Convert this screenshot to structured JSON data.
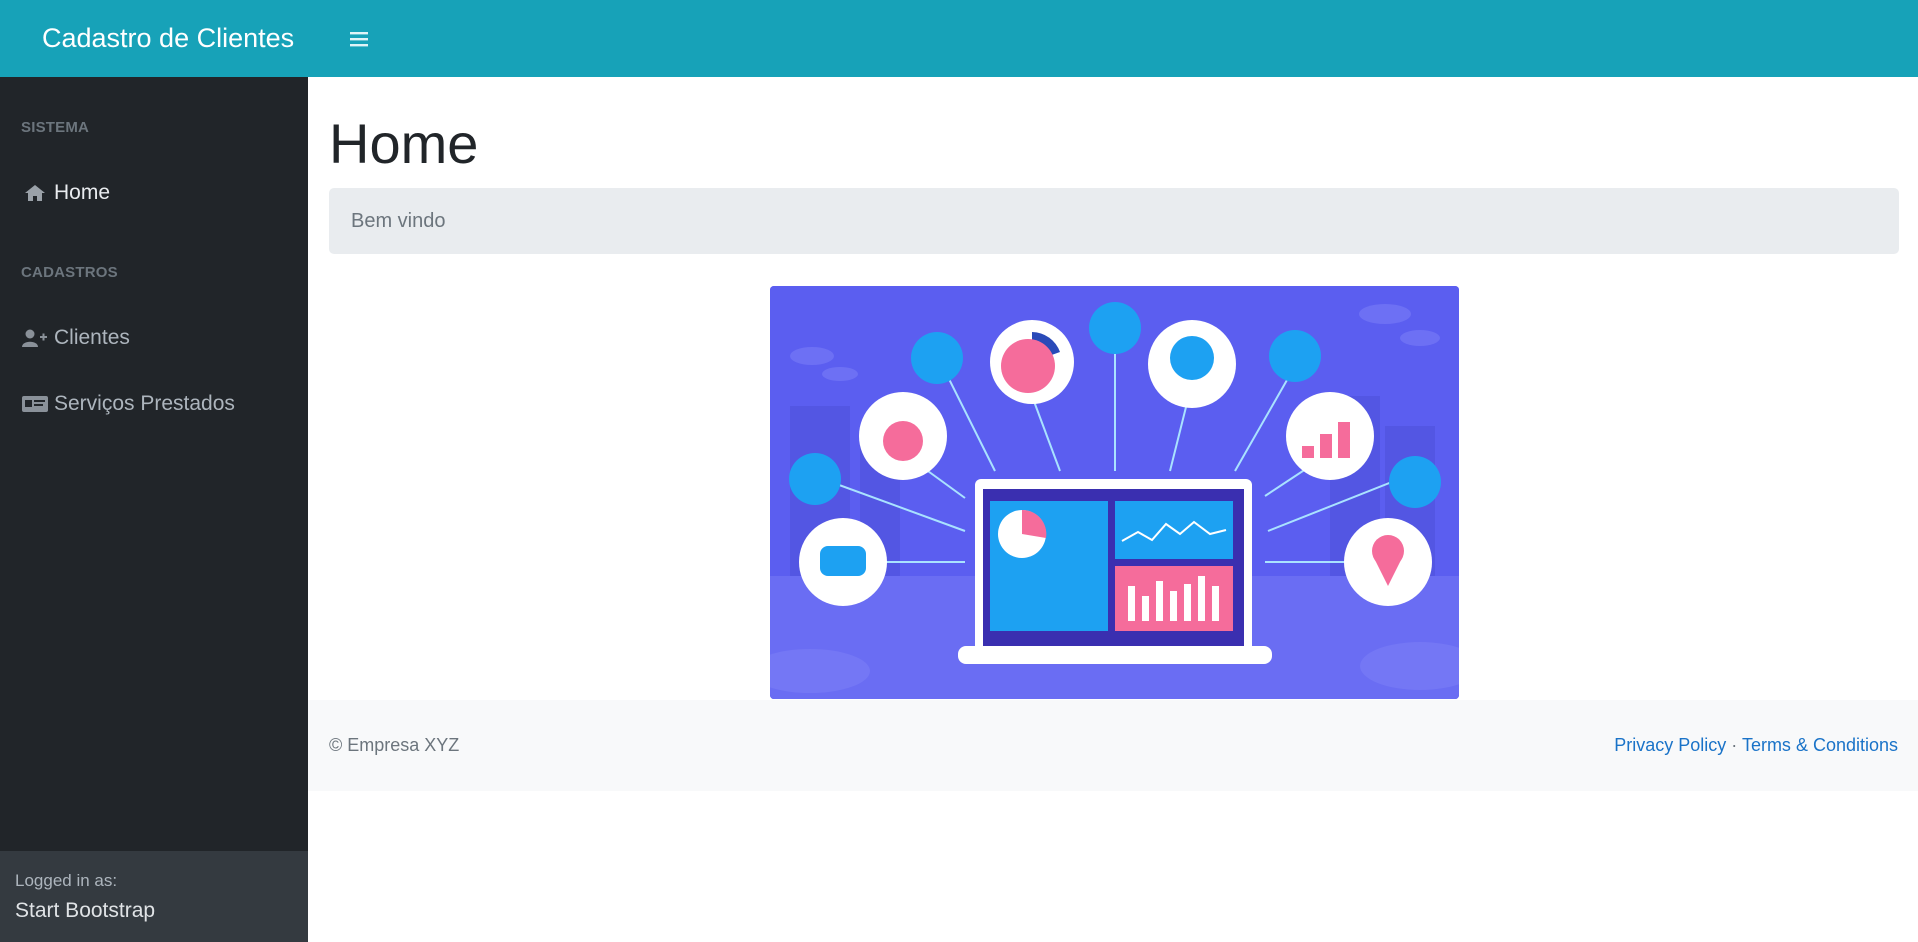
{
  "topbar": {
    "brand": "Cadastro de Clientes",
    "toggle_icon": "bars-icon"
  },
  "sidebar": {
    "sections": [
      {
        "heading": "SISTEMA",
        "items": [
          {
            "label": "Home",
            "icon": "home-icon"
          }
        ]
      },
      {
        "heading": "CADASTROS",
        "items": [
          {
            "label": "Clientes",
            "icon": "user-plus-icon"
          },
          {
            "label": "Serviços Prestados",
            "icon": "id-card-icon"
          }
        ]
      }
    ],
    "footer": {
      "small": "Logged in as:",
      "name": "Start Bootstrap"
    }
  },
  "main": {
    "title": "Home",
    "breadcrumb": "Bem vindo"
  },
  "footer": {
    "copyright": "© Empresa XYZ",
    "privacy": "Privacy Policy",
    "separator": "·",
    "terms": "Terms & Conditions"
  },
  "colors": {
    "topbar": "#17a2b8",
    "sidebar": "#212529",
    "sidebar_footer": "#343a40",
    "breadcrumb_bg": "#e9ecef",
    "hero_bg": "#5b5ef0"
  }
}
